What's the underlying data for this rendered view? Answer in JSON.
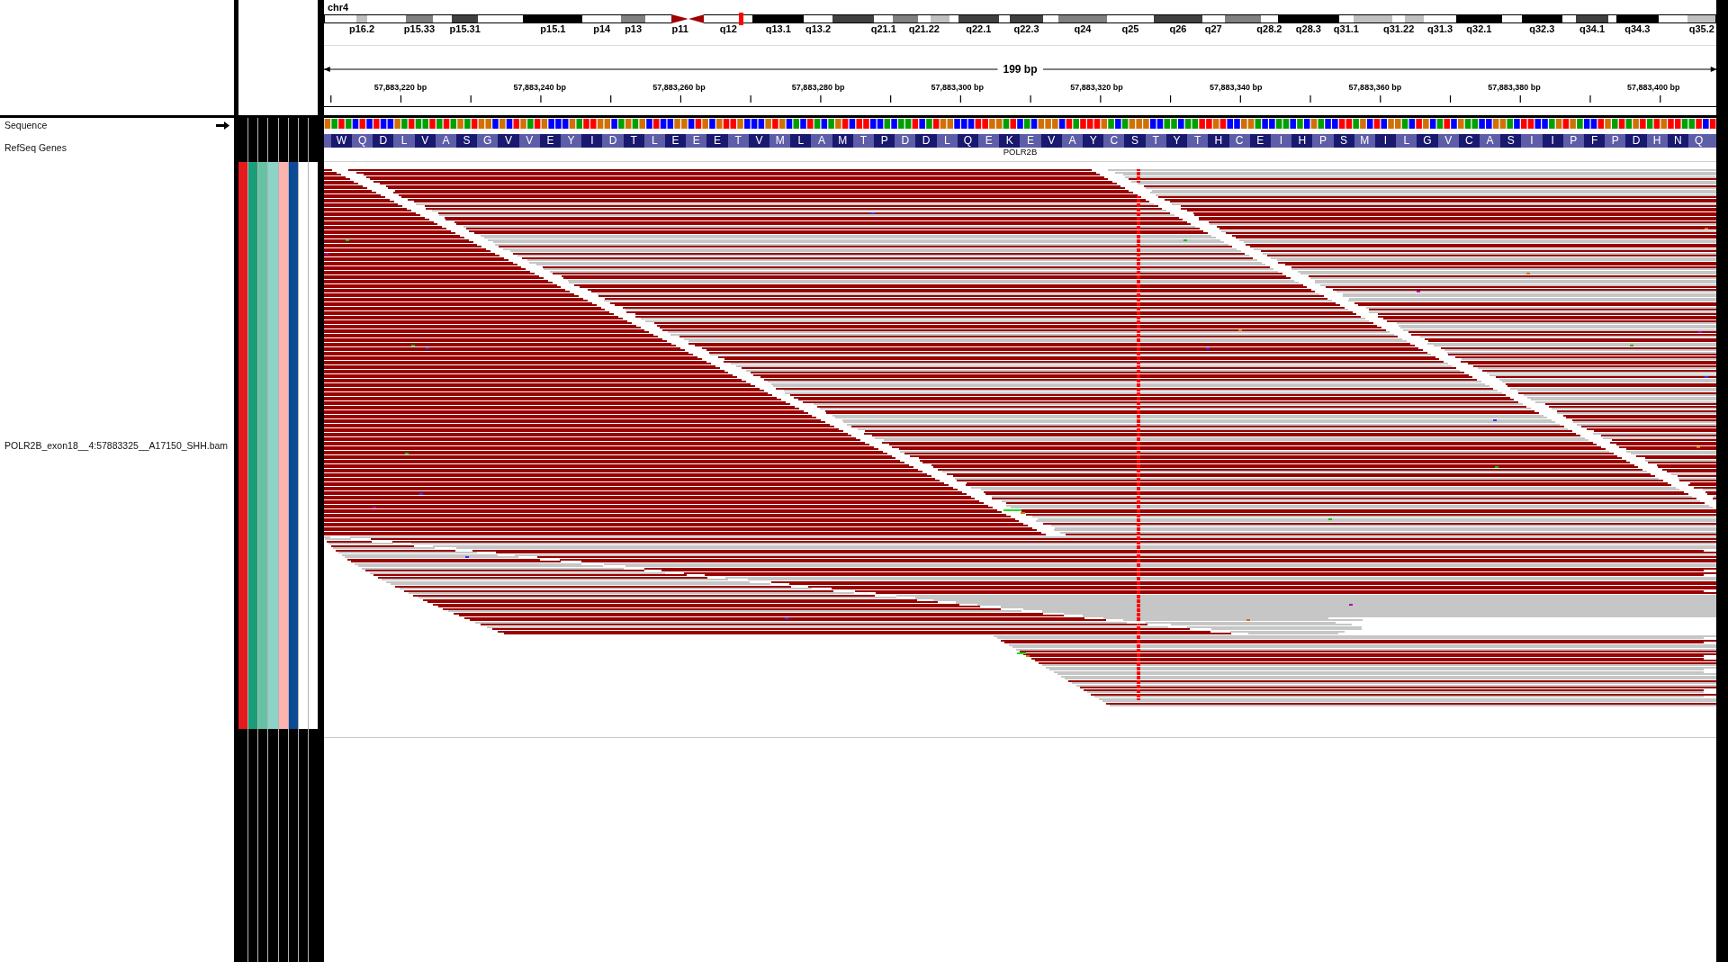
{
  "header": {
    "chromosome": "chr4",
    "bands": [
      {
        "kind": "gneg"
      },
      {
        "kind": "gpos25",
        "label": "p16.2"
      },
      {
        "kind": "gneg"
      },
      {
        "kind": "gpos50",
        "label": "p15.33"
      },
      {
        "kind": "gneg"
      },
      {
        "kind": "gpos75",
        "label": "p15.31"
      },
      {
        "kind": "gneg"
      },
      {
        "kind": "gpos100",
        "label": "p15.1"
      },
      {
        "kind": "gneg",
        "label": "p14"
      },
      {
        "kind": "gpos50",
        "label": "p13"
      },
      {
        "kind": "gneg"
      },
      {
        "kind": "acen",
        "label": "p11"
      },
      {
        "kind": "acen"
      },
      {
        "kind": "gneg",
        "label": "q12"
      },
      {
        "kind": "gpos100",
        "label": "q13.1"
      },
      {
        "kind": "gneg",
        "label": "q13.2"
      },
      {
        "kind": "gpos75"
      },
      {
        "kind": "gneg",
        "label": "q21.1"
      },
      {
        "kind": "gpos50"
      },
      {
        "kind": "gneg",
        "label": "q21.22"
      },
      {
        "kind": "gpos25"
      },
      {
        "kind": "gneg"
      },
      {
        "kind": "gpos75",
        "label": "q22.1"
      },
      {
        "kind": "gneg"
      },
      {
        "kind": "gpos75",
        "label": "q22.3"
      },
      {
        "kind": "gneg"
      },
      {
        "kind": "gpos50",
        "label": "q24"
      },
      {
        "kind": "gneg",
        "label": "q25"
      },
      {
        "kind": "gpos75",
        "label": "q26"
      },
      {
        "kind": "gneg",
        "label": "q27"
      },
      {
        "kind": "gpos50"
      },
      {
        "kind": "gneg",
        "label": "q28.2"
      },
      {
        "kind": "gpos100",
        "label": "q28.3"
      },
      {
        "kind": "gneg",
        "label": "q31.1"
      },
      {
        "kind": "gpos25"
      },
      {
        "kind": "gneg",
        "label": "q31.22"
      },
      {
        "kind": "gpos25"
      },
      {
        "kind": "gneg",
        "label": "q31.3"
      },
      {
        "kind": "gpos100",
        "label": "q32.1"
      },
      {
        "kind": "gneg"
      },
      {
        "kind": "gpos100",
        "label": "q32.3"
      },
      {
        "kind": "gneg"
      },
      {
        "kind": "gpos75",
        "label": "q34.1"
      },
      {
        "kind": "gneg"
      },
      {
        "kind": "gpos100",
        "label": "q34.3"
      },
      {
        "kind": "gneg"
      },
      {
        "kind": "gpos25",
        "label": "q35.2"
      }
    ]
  },
  "ruler": {
    "span": "199 bp",
    "ticks": [
      "57,883,220 bp",
      "57,883,240 bp",
      "57,883,260 bp",
      "57,883,280 bp",
      "57,883,300 bp",
      "57,883,320 bp",
      "57,883,340 bp",
      "57,883,360 bp",
      "57,883,380 bp",
      "57,883,400 bp"
    ]
  },
  "tracks": [
    {
      "kind": "sequence",
      "name": "Sequence"
    },
    {
      "kind": "gene",
      "name": "RefSeq Genes",
      "gene": "POLR2B",
      "amino_acids": [
        "W",
        "Q",
        "D",
        "L",
        "V",
        "A",
        "S",
        "G",
        "V",
        "V",
        "E",
        "Y",
        "I",
        "D",
        "T",
        "L",
        "E",
        "E",
        "E",
        "T",
        "V",
        "M",
        "L",
        "A",
        "M",
        "T",
        "P",
        "D",
        "D",
        "L",
        "Q",
        "E",
        "K",
        "E",
        "V",
        "A",
        "Y",
        "C",
        "S",
        "T",
        "Y",
        "T",
        "H",
        "C",
        "E",
        "I",
        "H",
        "P",
        "S",
        "M",
        "I",
        "L",
        "G",
        "V",
        "C",
        "A",
        "S",
        "I",
        "I",
        "P",
        "F",
        "P",
        "D",
        "H",
        "N",
        "Q"
      ]
    },
    {
      "kind": "alignment",
      "name": "POLR2B_exon18__4:57883325__A17150_SHH.bam",
      "attributes": [
        {
          "color": "#e41a1c"
        },
        {
          "color": "#1b9e77"
        },
        {
          "color": "#66c2a5"
        },
        {
          "color": "#8dd3c7"
        },
        {
          "color": "#fbb4ae"
        },
        {
          "color": "#0c4a96"
        },
        {
          "color": "#ffffff"
        },
        {
          "color": "#ffffff"
        }
      ]
    }
  ]
}
